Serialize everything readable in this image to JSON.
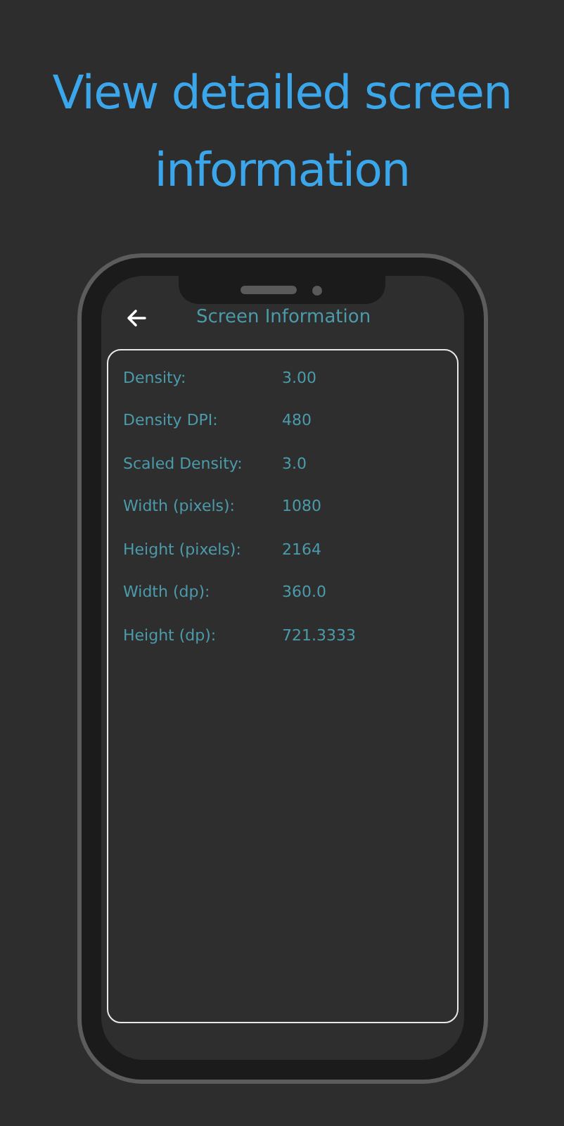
{
  "headline": "View detailed screen information",
  "app_bar": {
    "title": "Screen Information"
  },
  "rows": [
    {
      "label": "Density:",
      "value": "3.00"
    },
    {
      "label": "Density DPI:",
      "value": "480"
    },
    {
      "label": "Scaled Density:",
      "value": "3.0"
    },
    {
      "label": "Width (pixels):",
      "value": "1080"
    },
    {
      "label": "Height (pixels):",
      "value": "2164"
    },
    {
      "label": "Width (dp):",
      "value": "360.0"
    },
    {
      "label": "Height (dp):",
      "value": "721.3333"
    }
  ]
}
